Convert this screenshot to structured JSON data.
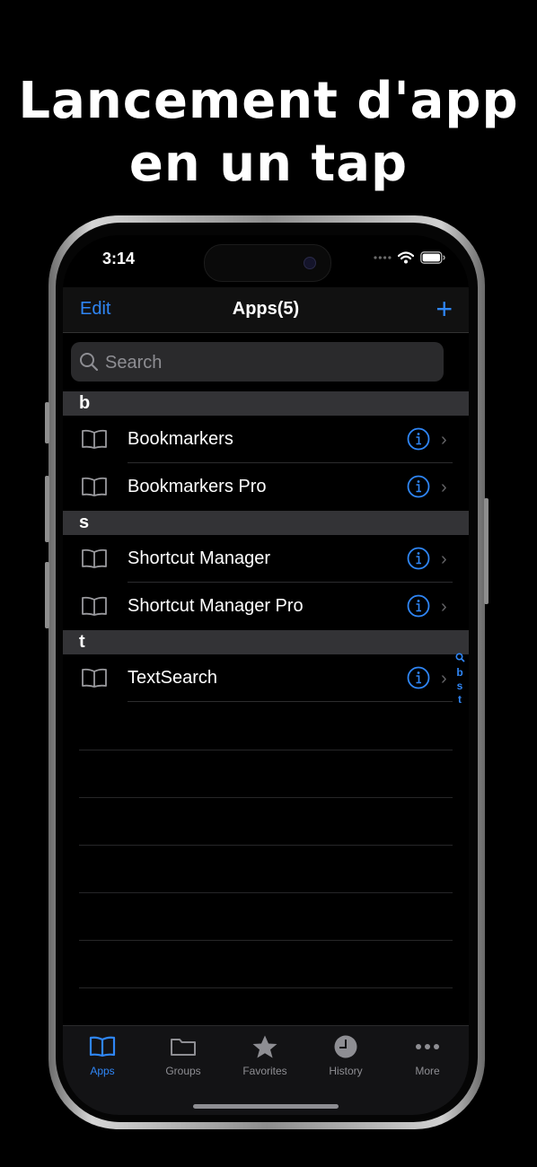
{
  "headline": [
    "Lancement d'app",
    "en un tap"
  ],
  "status": {
    "time": "3:14"
  },
  "nav": {
    "edit_label": "Edit",
    "title": "Apps(5)",
    "add_label": "+"
  },
  "search": {
    "placeholder": "Search"
  },
  "sections": [
    {
      "header": "b",
      "items": [
        "Bookmarkers",
        "Bookmarkers Pro"
      ]
    },
    {
      "header": "s",
      "items": [
        "Shortcut Manager",
        "Shortcut Manager Pro"
      ]
    },
    {
      "header": "t",
      "items": [
        "TextSearch"
      ]
    }
  ],
  "index_letters": [
    "b",
    "s",
    "t"
  ],
  "tabs": [
    {
      "label": "Apps",
      "icon": "book-icon",
      "active": true
    },
    {
      "label": "Groups",
      "icon": "folder-icon",
      "active": false
    },
    {
      "label": "Favorites",
      "icon": "star-icon",
      "active": false
    },
    {
      "label": "History",
      "icon": "clock-icon",
      "active": false
    },
    {
      "label": "More",
      "icon": "ellipsis-icon",
      "active": false
    }
  ],
  "colors": {
    "accent": "#2f86f6",
    "background": "#000000",
    "section_header": "#333336"
  }
}
